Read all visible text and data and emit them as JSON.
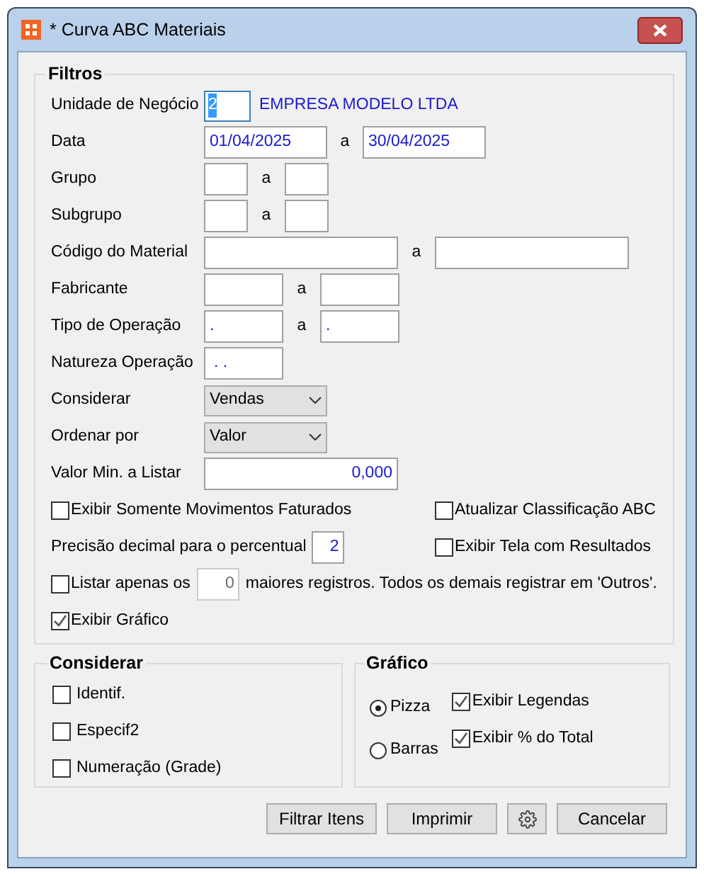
{
  "window": {
    "title": "* Curva ABC Materiais"
  },
  "filtros": {
    "title": "Filtros",
    "fields": [
      {
        "kind": "lookup",
        "label": "Unidade de Negócio",
        "value": "2",
        "text_selected": true,
        "description": "EMPRESA MODELO LTDA"
      },
      {
        "kind": "date_range",
        "label": "Data",
        "from": "01/04/2025",
        "separator": "a",
        "to": "30/04/2025"
      },
      {
        "kind": "small_range",
        "label": "Grupo",
        "separator": "a"
      },
      {
        "kind": "small_range",
        "label": "Subgrupo",
        "separator": "a"
      },
      {
        "kind": "wide_range",
        "label": "Código do Material",
        "separator": "a"
      },
      {
        "kind": "medium_range",
        "label": "Fabricante",
        "separator": "a"
      },
      {
        "kind": "medium_range",
        "label": "Tipo de Operação",
        "from": ".",
        "separator": "a",
        "to": "."
      },
      {
        "kind": "single",
        "label": "Natureza Operação",
        "value": ". ."
      },
      {
        "kind": "select",
        "label": "Considerar",
        "value": "Vendas"
      },
      {
        "kind": "select",
        "label": "Ordenar por",
        "value": "Valor"
      },
      {
        "kind": "number",
        "label": "Valor Min. a Listar",
        "value": "0,000"
      }
    ],
    "option_rows": [
      {
        "kind": "pair",
        "left": {
          "label": "Exibir Somente Movimentos Faturados",
          "checked": false
        },
        "right": {
          "label": "Atualizar Classificação ABC",
          "checked": false
        }
      },
      {
        "kind": "precision",
        "label": "Precisão decimal para o percentual",
        "value": "2",
        "right": {
          "label": "Exibir Tela com Resultados",
          "checked": false
        }
      },
      {
        "kind": "limit",
        "checked": false,
        "label_before": "Listar apenas os",
        "value": "0",
        "disabled": true,
        "label_after": "maiores registros. Todos os demais registrar em 'Outros'."
      },
      {
        "kind": "single",
        "left": {
          "label": "Exibir Gráfico",
          "checked": true
        }
      }
    ]
  },
  "considerar": {
    "title": "Considerar",
    "checkboxes": [
      {
        "label": "Identif.",
        "checked": false
      },
      {
        "label": "Especif2",
        "checked": false
      },
      {
        "label": "Numeração (Grade)",
        "checked": false
      }
    ]
  },
  "grafico": {
    "title": "Gráfico",
    "radios": [
      {
        "label": "Pizza",
        "selected": true
      },
      {
        "label": "Barras",
        "selected": false
      }
    ],
    "checkboxes": [
      {
        "label": "Exibir Legendas",
        "checked": true
      },
      {
        "label": "Exibir % do Total",
        "checked": true
      }
    ]
  },
  "buttons": [
    {
      "kind": "text",
      "label": "Filtrar Itens"
    },
    {
      "kind": "text",
      "label": "Imprimir"
    },
    {
      "kind": "settings"
    },
    {
      "kind": "text",
      "label": "Cancelar"
    }
  ]
}
